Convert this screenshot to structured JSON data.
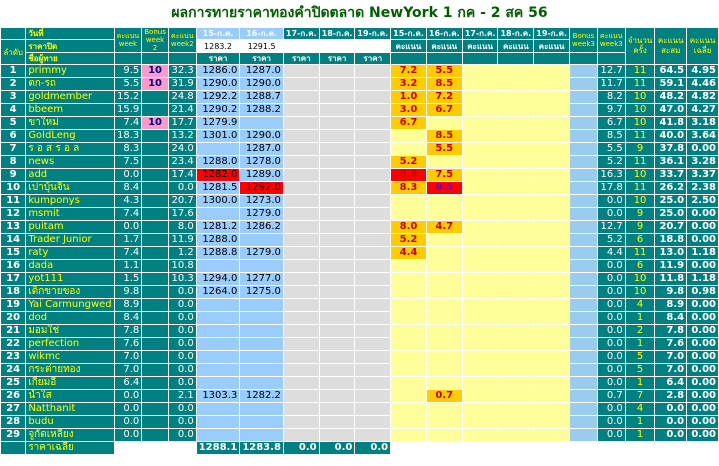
{
  "title": "ผลการทายราคาทองคำปิดตลาด NewYork 1 กค - 2 สค 56",
  "headers": {
    "rank": "ลำดับ",
    "date_label": "วันที่",
    "close_label": "ราคาปิด",
    "player_label": "ชื่อผู้ทาย",
    "score_w": "คะแนน week",
    "bonus_w2": "Bonus week 2",
    "score_w2": "คะแนน week2",
    "dates": [
      "15-ก.ค.",
      "16-ก.ค.",
      "17-ก.ค.",
      "18-ก.ค.",
      "19-ก.ค."
    ],
    "close_values": [
      "1283.2",
      "1291.5",
      "",
      "",
      ""
    ],
    "price_label": "ราคา",
    "score_dates": [
      "15-ก.ค.",
      "16-ก.ค.",
      "17-ก.ค.",
      "18-ก.ค.",
      "19-ก.ค."
    ],
    "score_label": "คะแนน",
    "bonus_w3": "Bonus week3",
    "score_w3": "คะแนน week3",
    "count_label": "จำนวน ครั้ง",
    "total_label": "คะแนน สะสม",
    "avg_label": "คะแนน เฉลี่ย"
  },
  "rows": [
    {
      "rank": "1",
      "name": "primmy",
      "w": "9.5",
      "bw2": "10",
      "w2": "32.3",
      "p1": "1286.0",
      "p2": "1287.0",
      "s1": "7.2",
      "s2": "5.5",
      "w3": "12.7",
      "cnt": "11",
      "tot": "64.5",
      "avg": "4.95"
    },
    {
      "rank": "2",
      "name": "ตก-รถ",
      "w": "5.5",
      "bw2": "10",
      "w2": "31.9",
      "p1": "1290.0",
      "p2": "1290.0",
      "s1": "3.2",
      "s2": "8.5",
      "w3": "11.7",
      "cnt": "11",
      "tot": "59.1",
      "avg": "4.46"
    },
    {
      "rank": "3",
      "name": "goldmember",
      "w": "15.2",
      "bw2": "",
      "w2": "24.8",
      "p1": "1292.2",
      "p2": "1288.7",
      "s1": "1.0",
      "s2": "7.2",
      "w3": "8.2",
      "cnt": "10",
      "tot": "48.2",
      "avg": "4.82"
    },
    {
      "rank": "4",
      "name": "bbeem",
      "w": "15.9",
      "bw2": "",
      "w2": "21.4",
      "p1": "1290.2",
      "p2": "1288.2",
      "s1": "3.0",
      "s2": "6.7",
      "w3": "9.7",
      "cnt": "10",
      "tot": "47.0",
      "avg": "4.27"
    },
    {
      "rank": "5",
      "name": "ขาใหม่",
      "w": "7.4",
      "bw2": "10",
      "w2": "17.7",
      "p1": "1279.9",
      "p2": "",
      "s1": "6.7",
      "s2": "",
      "w3": "6.7",
      "cnt": "10",
      "tot": "41.8",
      "avg": "3.18"
    },
    {
      "rank": "6",
      "name": "GoldLeng",
      "w": "18.3",
      "bw2": "",
      "w2": "13.2",
      "p1": "1301.0",
      "p2": "1290.0",
      "s1": "",
      "s2": "8.5",
      "w3": "8.5",
      "cnt": "11",
      "tot": "40.0",
      "avg": "3.64"
    },
    {
      "rank": "7",
      "name": "ร อ ส ร อ ล",
      "w": "8.3",
      "bw2": "",
      "w2": "24.0",
      "p1": "",
      "p2": "1287.0",
      "s1": "",
      "s2": "5.5",
      "w3": "5.5",
      "cnt": "9",
      "tot": "37.8",
      "avg": "0.00"
    },
    {
      "rank": "8",
      "name": "news",
      "w": "7.5",
      "bw2": "",
      "w2": "23.4",
      "p1": "1288.0",
      "p2": "1278.0",
      "s1": "5.2",
      "s2": "",
      "w3": "5.2",
      "cnt": "11",
      "tot": "36.1",
      "avg": "3.28"
    },
    {
      "rank": "9",
      "name": "add",
      "w": "0.0",
      "bw2": "",
      "w2": "17.4",
      "p1": "1282.0",
      "p2": "1289.0",
      "s1": "8.8",
      "s2": "7.5",
      "w3": "16.3",
      "cnt": "10",
      "tot": "33.7",
      "avg": "3.37"
    },
    {
      "rank": "10",
      "name": "เปาบุ้นจิ้น",
      "w": "8.4",
      "bw2": "",
      "w2": "0.0",
      "p1": "1281.5",
      "p2": "1292.0",
      "s1": "8.3",
      "s2": "9.5",
      "w3": "17.8",
      "cnt": "11",
      "tot": "26.2",
      "avg": "2.38"
    },
    {
      "rank": "11",
      "name": "kumponys",
      "w": "4.3",
      "bw2": "",
      "w2": "20.7",
      "p1": "1300.0",
      "p2": "1273.0",
      "s1": "",
      "s2": "",
      "w3": "0.0",
      "cnt": "10",
      "tot": "25.0",
      "avg": "2.50"
    },
    {
      "rank": "12",
      "name": "msmit",
      "w": "7.4",
      "bw2": "",
      "w2": "17.6",
      "p1": "",
      "p2": "1279.0",
      "s1": "",
      "s2": "",
      "w3": "0.0",
      "cnt": "9",
      "tot": "25.0",
      "avg": "0.00"
    },
    {
      "rank": "13",
      "name": "puitam",
      "w": "0.0",
      "bw2": "",
      "w2": "8.0",
      "p1": "1281.2",
      "p2": "1286.2",
      "s1": "8.0",
      "s2": "4.7",
      "w3": "12.7",
      "cnt": "9",
      "tot": "20.7",
      "avg": "0.00"
    },
    {
      "rank": "14",
      "name": "Trader Junior",
      "w": "1.7",
      "bw2": "",
      "w2": "11.9",
      "p1": "1288.0",
      "p2": "",
      "s1": "5.2",
      "s2": "",
      "w3": "5.2",
      "cnt": "6",
      "tot": "18.8",
      "avg": "0.00"
    },
    {
      "rank": "15",
      "name": "raty",
      "w": "7.4",
      "bw2": "",
      "w2": "1.2",
      "p1": "1288.8",
      "p2": "1279.0",
      "s1": "4.4",
      "s2": "",
      "w3": "4.4",
      "cnt": "11",
      "tot": "13.0",
      "avg": "1.18"
    },
    {
      "rank": "16",
      "name": "dada",
      "w": "1.1",
      "bw2": "",
      "w2": "10.8",
      "p1": "",
      "p2": "",
      "s1": "",
      "s2": "",
      "w3": "0.0",
      "cnt": "6",
      "tot": "11.9",
      "avg": "0.00"
    },
    {
      "rank": "17",
      "name": "yot111",
      "w": "1.5",
      "bw2": "",
      "w2": "10.3",
      "p1": "1294.0",
      "p2": "1277.0",
      "s1": "",
      "s2": "",
      "w3": "0.0",
      "cnt": "10",
      "tot": "11.8",
      "avg": "1.18"
    },
    {
      "rank": "18",
      "name": "เด็กขายของ",
      "w": "9.8",
      "bw2": "",
      "w2": "0.0",
      "p1": "1264.0",
      "p2": "1275.0",
      "s1": "",
      "s2": "",
      "w3": "0.0",
      "cnt": "10",
      "tot": "9.8",
      "avg": "0.98"
    },
    {
      "rank": "19",
      "name": "Yai Carmungwed",
      "w": "8.9",
      "bw2": "",
      "w2": "0.0",
      "p1": "",
      "p2": "",
      "s1": "",
      "s2": "",
      "w3": "0.0",
      "cnt": "4",
      "tot": "8.9",
      "avg": "0.00"
    },
    {
      "rank": "20",
      "name": "dod",
      "w": "8.4",
      "bw2": "",
      "w2": "0.0",
      "p1": "",
      "p2": "",
      "s1": "",
      "s2": "",
      "w3": "0.0",
      "cnt": "1",
      "tot": "8.4",
      "avg": "0.00"
    },
    {
      "rank": "21",
      "name": "มอมใช่",
      "w": "7.8",
      "bw2": "",
      "w2": "0.0",
      "p1": "",
      "p2": "",
      "s1": "",
      "s2": "",
      "w3": "0.0",
      "cnt": "2",
      "tot": "7.8",
      "avg": "0.00"
    },
    {
      "rank": "22",
      "name": "perfection",
      "w": "7.6",
      "bw2": "",
      "w2": "0.0",
      "p1": "",
      "p2": "",
      "s1": "",
      "s2": "",
      "w3": "0.0",
      "cnt": "1",
      "tot": "7.6",
      "avg": "0.00"
    },
    {
      "rank": "23",
      "name": "wikmc",
      "w": "7.0",
      "bw2": "",
      "w2": "0.0",
      "p1": "",
      "p2": "",
      "s1": "",
      "s2": "",
      "w3": "0.0",
      "cnt": "5",
      "tot": "7.0",
      "avg": "0.00"
    },
    {
      "rank": "24",
      "name": "กระต่ายทอง",
      "w": "7.0",
      "bw2": "",
      "w2": "0.0",
      "p1": "",
      "p2": "",
      "s1": "",
      "s2": "",
      "w3": "0.0",
      "cnt": "5",
      "tot": "7.0",
      "avg": "0.00"
    },
    {
      "rank": "25",
      "name": "เกี้ยมอี๋",
      "w": "6.4",
      "bw2": "",
      "w2": "0.0",
      "p1": "",
      "p2": "",
      "s1": "",
      "s2": "",
      "w3": "0.0",
      "cnt": "1",
      "tot": "6.4",
      "avg": "0.00"
    },
    {
      "rank": "26",
      "name": "น้ำใส",
      "w": "0.0",
      "bw2": "",
      "w2": "2.1",
      "p1": "1303.3",
      "p2": "1282.2",
      "s1": "",
      "s2": "0.7",
      "w3": "0.7",
      "cnt": "7",
      "tot": "2.8",
      "avg": "0.00"
    },
    {
      "rank": "27",
      "name": "Natthanit",
      "w": "0.0",
      "bw2": "",
      "w2": "0.0",
      "p1": "",
      "p2": "",
      "s1": "",
      "s2": "",
      "w3": "0.0",
      "cnt": "4",
      "tot": "0.0",
      "avg": "0.00"
    },
    {
      "rank": "28",
      "name": "budu",
      "w": "0.0",
      "bw2": "",
      "w2": "0.0",
      "p1": "",
      "p2": "",
      "s1": "",
      "s2": "",
      "w3": "0.0",
      "cnt": "1",
      "tot": "0.0",
      "avg": "0.00"
    },
    {
      "rank": "29",
      "name": "จูกัดเหลียง",
      "w": "0.0",
      "bw2": "",
      "w2": "0.0",
      "p1": "",
      "p2": "",
      "s1": "",
      "s2": "",
      "w3": "0.0",
      "cnt": "1",
      "tot": "0.0",
      "avg": "0.00"
    }
  ],
  "footer": {
    "label": "ราคาเฉลี่ย",
    "avgs": [
      "1288.1",
      "1283.8",
      "0.0",
      "0.0",
      "0.0"
    ]
  },
  "colors": {
    "teal": "#008080",
    "gold": "#ffcc00",
    "pink": "#ff99cc",
    "red": "#ff0000",
    "yellow_cells": "#ffff99"
  }
}
